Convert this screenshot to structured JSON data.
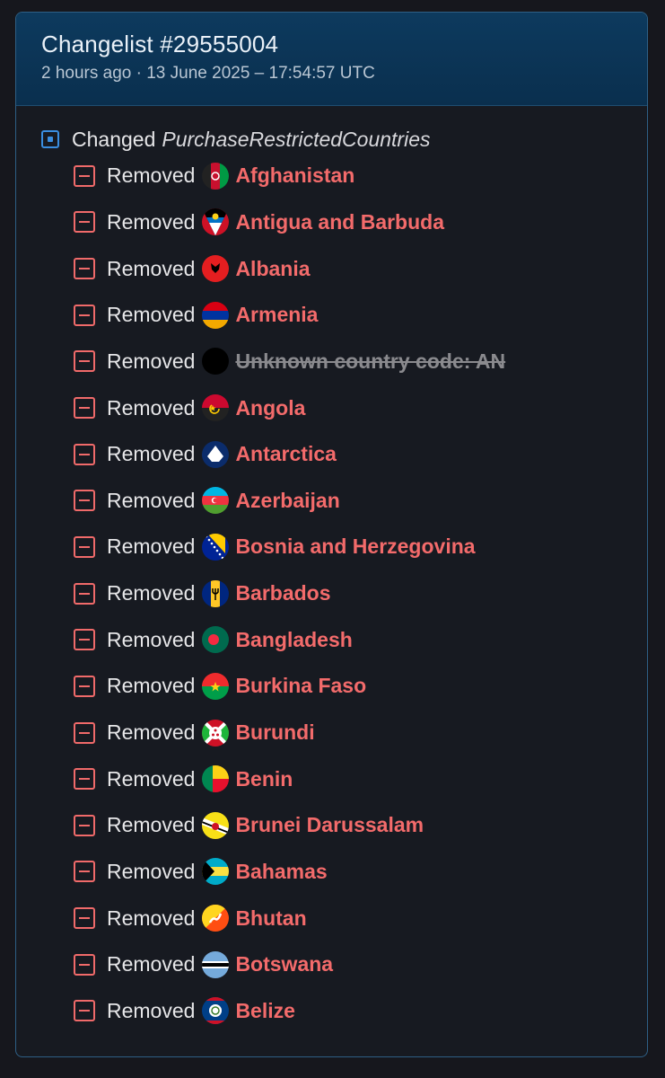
{
  "header": {
    "title": "Changelist #29555004",
    "subtitle": "2 hours ago · 13 June 2025 – 17:54:57 UTC"
  },
  "change": {
    "label": "Changed",
    "field": "PurchaseRestrictedCountries"
  },
  "removed_label": "Removed",
  "countries": [
    {
      "name": "Afghanistan",
      "flag": "flag-afghanistan"
    },
    {
      "name": "Antigua and Barbuda",
      "flag": "flag-antigua-and-barbuda"
    },
    {
      "name": "Albania",
      "flag": "flag-albania"
    },
    {
      "name": "Armenia",
      "flag": "flag-armenia"
    },
    {
      "name": "Unknown country code: AN",
      "flag": "flag-unknown",
      "unknown": true
    },
    {
      "name": "Angola",
      "flag": "flag-angola"
    },
    {
      "name": "Antarctica",
      "flag": "flag-antarctica"
    },
    {
      "name": "Azerbaijan",
      "flag": "flag-azerbaijan"
    },
    {
      "name": "Bosnia and Herzegovina",
      "flag": "flag-bosnia-and-herzegovina"
    },
    {
      "name": "Barbados",
      "flag": "flag-barbados"
    },
    {
      "name": "Bangladesh",
      "flag": "flag-bangladesh"
    },
    {
      "name": "Burkina Faso",
      "flag": "flag-burkina-faso"
    },
    {
      "name": "Burundi",
      "flag": "flag-burundi"
    },
    {
      "name": "Benin",
      "flag": "flag-benin"
    },
    {
      "name": "Brunei Darussalam",
      "flag": "flag-brunei"
    },
    {
      "name": "Bahamas",
      "flag": "flag-bahamas"
    },
    {
      "name": "Bhutan",
      "flag": "flag-bhutan"
    },
    {
      "name": "Botswana",
      "flag": "flag-botswana"
    },
    {
      "name": "Belize",
      "flag": "flag-belize"
    }
  ],
  "colors": {
    "removed": "#f06a6a",
    "changed": "#3a8ee0",
    "header_bg": "#0d3a5e"
  }
}
